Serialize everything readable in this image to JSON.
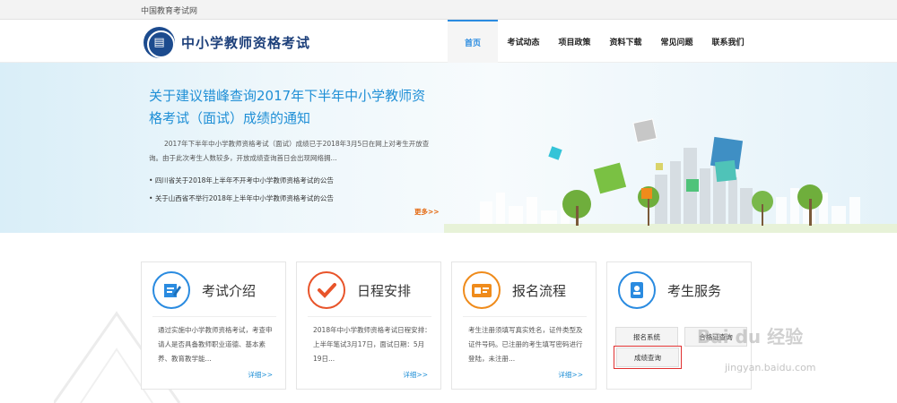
{
  "topbar": {
    "org": "中国教育考试网"
  },
  "header": {
    "title": "中小学教师资格考试",
    "nav": [
      {
        "label": "首页",
        "active": true
      },
      {
        "label": "考试动态"
      },
      {
        "label": "项目政策"
      },
      {
        "label": "资料下载"
      },
      {
        "label": "常见问题"
      },
      {
        "label": "联系我们"
      }
    ]
  },
  "hero": {
    "title": "关于建议错峰查询2017年下半年中小学教师资格考试（面试）成绩的通知",
    "desc": "2017年下半年中小学教师资格考试（面试）成绩已于2018年3月5日在网上对考生开放查询。由于此次考生人数较多，开放成绩查询首日会出现网络拥...",
    "notices": [
      "四川省关于2018年上半年不开考中小学教师资格考试的公告",
      "关于山西省不举行2018年上半年中小学教师资格考试的公告"
    ],
    "more": "更多>>"
  },
  "cards": [
    {
      "title": "考试介绍",
      "text": "通过实施中小学教师资格考试，考查申请人是否具备教师职业道德、基本素养、教育教学能...",
      "more": "详细>>",
      "icon": "document-edit-icon",
      "color": "#2a8be0"
    },
    {
      "title": "日程安排",
      "text": "2018年中小学教师资格考试日程安排：上半年笔试3月17日，面试日期：5月19日...",
      "more": "详细>>",
      "icon": "checkmark-icon",
      "color": "#e8542a"
    },
    {
      "title": "报名流程",
      "text": "考生注册须填写真实姓名，证件类型及证件号码。已注册的考生填写密码进行登陆，未注册...",
      "more": "详细>>",
      "icon": "id-card-icon",
      "color": "#ef8b1b"
    },
    {
      "title": "考生服务",
      "icon": "contact-book-icon",
      "color": "#2a8be0",
      "buttons": [
        "报名系统",
        "合格证查询",
        "成绩查询"
      ]
    }
  ],
  "watermark": {
    "brand": "Bai du 经验",
    "url": "jingyan.baidu.com"
  }
}
